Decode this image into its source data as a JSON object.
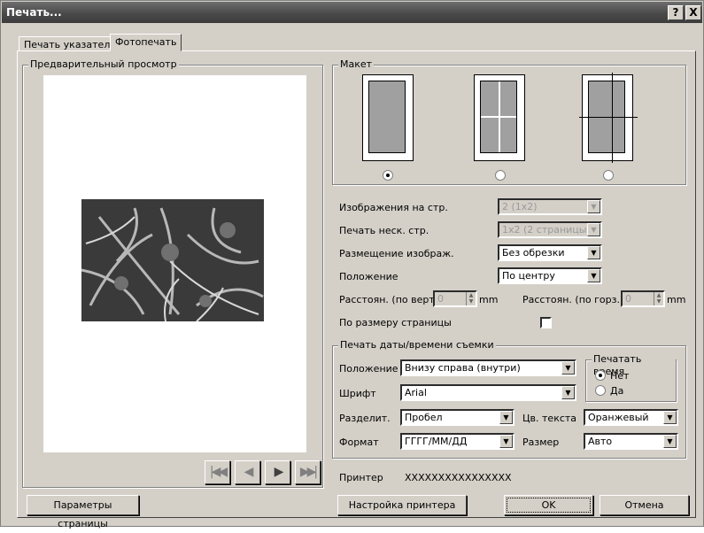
{
  "window": {
    "title": "Печать...",
    "help": "?",
    "close": "X"
  },
  "tabs": [
    "Печать указателя",
    "Фотопечать"
  ],
  "preview": {
    "title": "Предварительный просмотр"
  },
  "layout": {
    "title": "Макет"
  },
  "fields": {
    "images_per_page": {
      "label": "Изображения на стр.",
      "value": "2 (1x2)"
    },
    "multi_page": {
      "label": "Печать неск. стр.",
      "value": "1x2 (2 страницы)"
    },
    "placement": {
      "label": "Размещение изображ.",
      "value": "Без обрезки"
    },
    "position": {
      "label": "Положение",
      "value": "По центру"
    },
    "vspacing": {
      "label": "Расстоян. (по верт.)",
      "value": "0",
      "unit": "mm"
    },
    "hspacing": {
      "label": "Расстоян. (по горз.)",
      "value": "0",
      "unit": "mm"
    },
    "fit_page": {
      "label": "По размеру страницы"
    }
  },
  "date": {
    "title": "Печать даты/времени съемки",
    "position": {
      "label": "Положение",
      "value": "Внизу справа (внутри)"
    },
    "font": {
      "label": "Шрифт",
      "value": "Arial"
    },
    "separator": {
      "label": "Разделит.",
      "value": "Пробел"
    },
    "text_color": {
      "label": "Цв. текста",
      "value": "Оранжевый"
    },
    "format": {
      "label": "Формат",
      "value": "ГГГГ/ММ/ДД"
    },
    "size": {
      "label": "Размер",
      "value": "Авто"
    },
    "print_time": {
      "title": "Печатать время",
      "no": "Нет",
      "yes": "Да"
    }
  },
  "printer": {
    "label": "Принтер",
    "value": "XXXXXXXXXXXXXXXX"
  },
  "buttons": {
    "page_setup": "Параметры страницы",
    "printer_setup": "Настройка принтера",
    "ok": "OK",
    "cancel": "Отмена"
  },
  "nav": {
    "first": "|◀◀",
    "prev": "◀",
    "next": "▶",
    "last": "▶▶|"
  }
}
